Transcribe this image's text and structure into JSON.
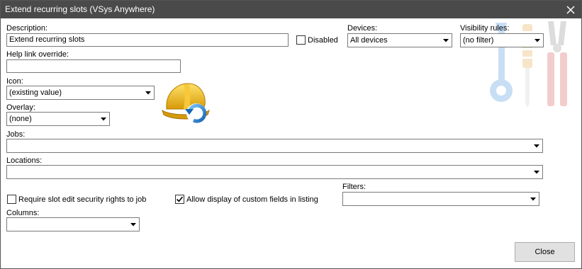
{
  "window": {
    "title": "Extend recurring slots (VSys Anywhere)"
  },
  "form": {
    "description": {
      "label": "Description:",
      "value": "Extend recurring slots"
    },
    "disabled": {
      "label": "Disabled",
      "checked": false
    },
    "devices": {
      "label": "Devices:",
      "value": "All devices"
    },
    "visibility_rules": {
      "label": "Visibility rules:",
      "value": "(no filter)"
    },
    "help_link": {
      "label": "Help link override:",
      "value": ""
    },
    "icon": {
      "label": "Icon:",
      "value": "(existing value)"
    },
    "overlay": {
      "label": "Overlay:",
      "value": "(none)"
    },
    "jobs": {
      "label": "Jobs:",
      "value": ""
    },
    "locations": {
      "label": "Locations:",
      "value": ""
    },
    "require_slot_edit": {
      "label": "Require slot edit security rights to job",
      "checked": false
    },
    "allow_custom_fields": {
      "label": "Allow display of custom fields in listing",
      "checked": true
    },
    "filters": {
      "label": "Filters:",
      "value": ""
    },
    "columns": {
      "label": "Columns:",
      "value": ""
    }
  },
  "buttons": {
    "close": "Close"
  },
  "icons": {
    "preview": "hardhat-refresh-icon",
    "watermark": "tools-watermark-icon"
  },
  "colors": {
    "titlebar": "#4a4a4a",
    "accent": "#1f7fd6"
  }
}
